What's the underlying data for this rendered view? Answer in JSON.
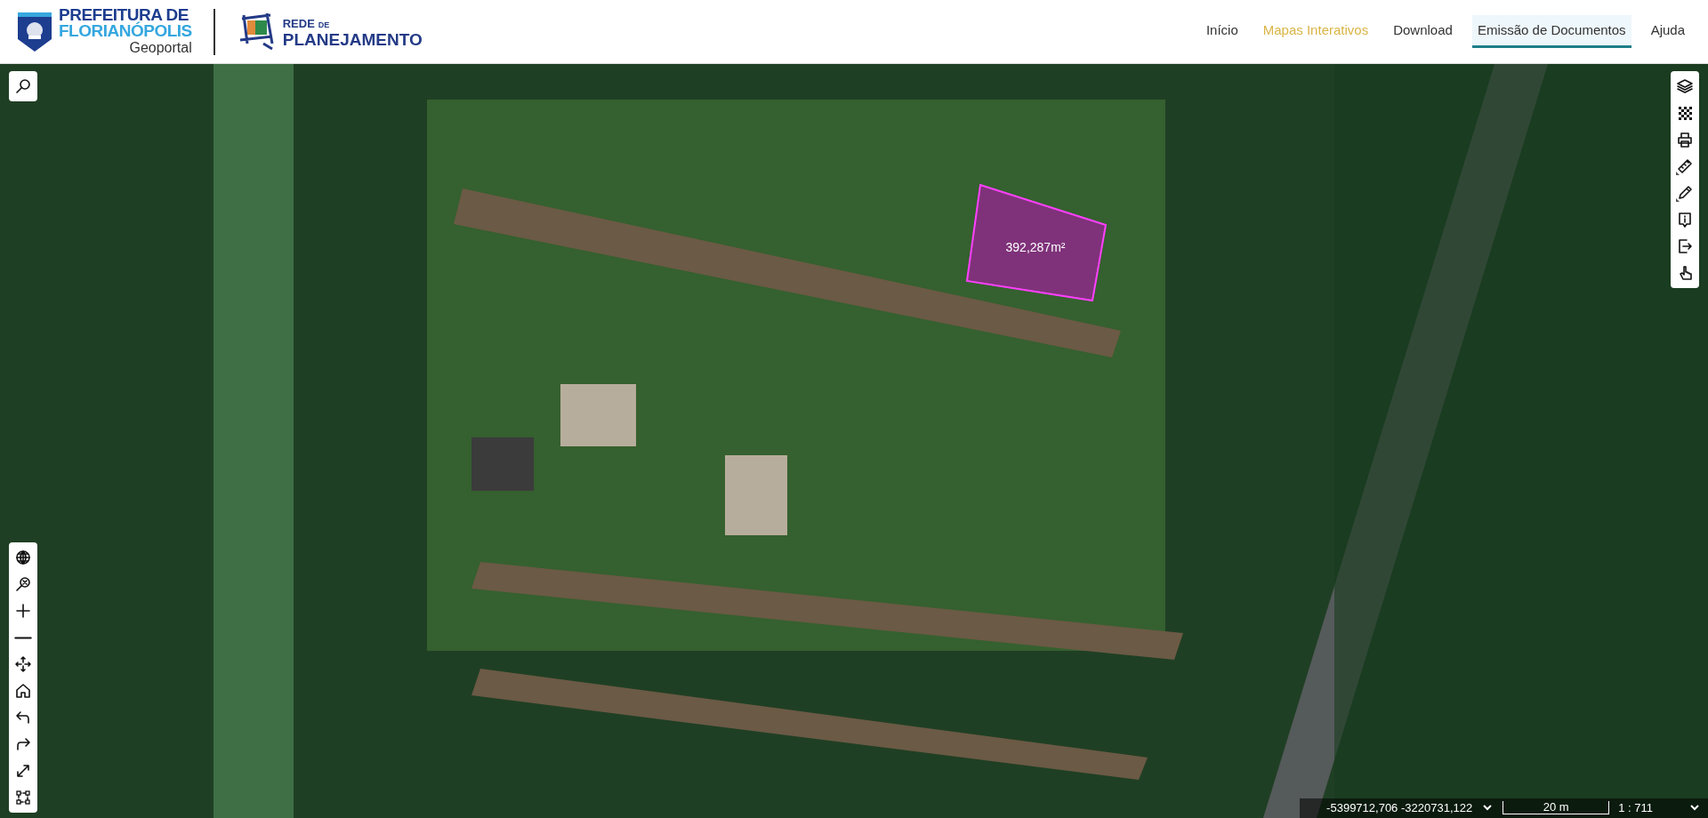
{
  "header": {
    "logo_city": {
      "line1": "PREFEITURA DE",
      "line2": "FLORIANÓPOLIS",
      "subtitle": "Geoportal"
    },
    "logo_network": {
      "word1": "REDE",
      "word2": "DE",
      "word3": "PLANEJAMENTO"
    },
    "nav": [
      {
        "label": "Início",
        "selected": false,
        "highlighted": false
      },
      {
        "label": "Mapas Interativos",
        "selected": false,
        "highlighted": true
      },
      {
        "label": "Download",
        "selected": false,
        "highlighted": false
      },
      {
        "label": "Emissão de Documentos",
        "selected": true,
        "highlighted": false
      },
      {
        "label": "Ajuda",
        "selected": false,
        "highlighted": false
      }
    ]
  },
  "map": {
    "measurement": {
      "label": "392,287m²"
    },
    "top_left_tools": [
      {
        "kind": "search"
      }
    ],
    "right_tools": [
      {
        "kind": "layers",
        "has_menu": false
      },
      {
        "kind": "checker",
        "has_menu": false
      },
      {
        "kind": "print",
        "has_menu": false
      },
      {
        "kind": "ruler",
        "has_menu": true
      },
      {
        "kind": "pencil",
        "has_menu": true
      },
      {
        "kind": "info",
        "has_menu": false
      },
      {
        "kind": "export",
        "has_menu": false
      },
      {
        "kind": "hand",
        "has_menu": false
      }
    ],
    "left_tools": [
      {
        "kind": "globe"
      },
      {
        "kind": "zoom-extent"
      },
      {
        "kind": "plus"
      },
      {
        "kind": "minus"
      },
      {
        "kind": "pan"
      },
      {
        "kind": "home"
      },
      {
        "kind": "undo"
      },
      {
        "kind": "redo"
      },
      {
        "kind": "fullscreen"
      },
      {
        "kind": "select"
      }
    ],
    "status_bar": {
      "coordinates": "-5399712,706 -3220731,122",
      "scale_bar": "20 m",
      "scale": "1 : 711"
    }
  }
}
